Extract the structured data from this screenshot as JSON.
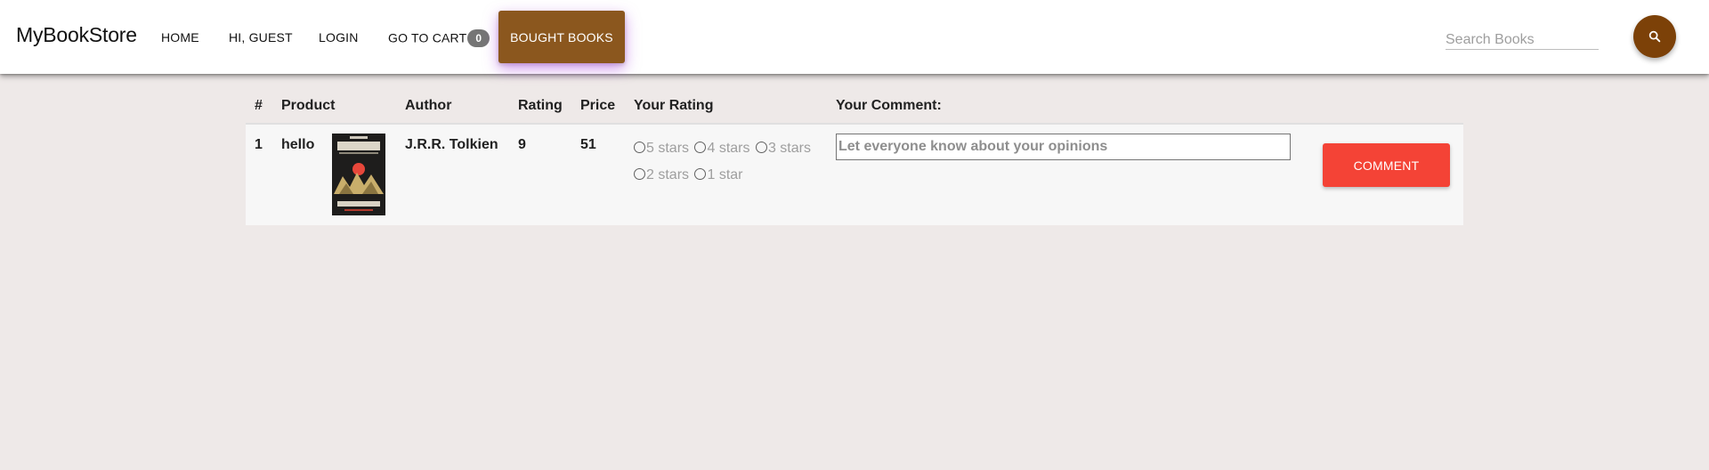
{
  "brand": "MyBookStore",
  "nav": {
    "home": "HOME",
    "guest": "HI, GUEST",
    "login": "LOGIN",
    "cart": "GO TO CART",
    "cart_count": "0",
    "bought": "BOUGHT BOOKS"
  },
  "search": {
    "placeholder": "Search Books",
    "icon": "search-icon"
  },
  "table": {
    "headers": [
      "#",
      "Product",
      "Author",
      "Rating",
      "Price",
      "Your Rating",
      "Your Comment:"
    ],
    "rows": [
      {
        "index": "1",
        "product": "hello",
        "author": "J.R.R. Tolkien",
        "rating": "9",
        "price": "51",
        "rating_options": [
          "5 stars",
          "4 stars",
          "3 stars",
          "2 stars",
          "1 star"
        ],
        "comment_placeholder": "Let everyone know about your opinions",
        "comment_button": "COMMENT"
      }
    ]
  },
  "colors": {
    "background": "#eee9e8",
    "bought_button": "#8b571e",
    "search_button": "#7c4108",
    "comment_button": "#f44336",
    "badge": "#757575"
  }
}
